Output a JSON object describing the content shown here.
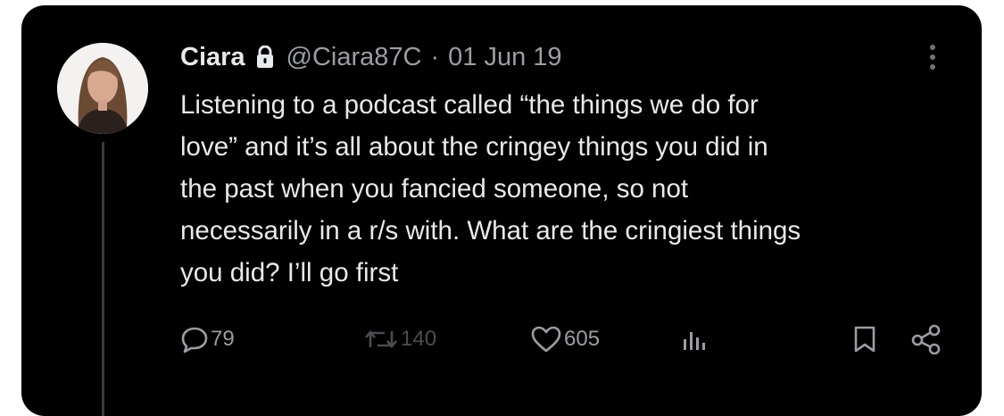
{
  "tweet": {
    "author_name": "Ciara",
    "handle": "@Ciara87C",
    "separator": "·",
    "date": "01 Jun 19",
    "protected_icon": "lock-icon",
    "text_lines": [
      "Listening to a podcast called “the things we do for",
      "love” and it’s all about the cringey things you did in",
      "the past when you fancied someone, so not",
      "necessarily in a r/s with. What are the cringiest things",
      "you did? I’ll go first"
    ]
  },
  "actions": {
    "reply": {
      "icon": "reply-icon",
      "count": "79"
    },
    "retweet": {
      "icon": "retweet-icon",
      "count": "140"
    },
    "like": {
      "icon": "heart-icon",
      "count": "605"
    },
    "views": {
      "icon": "views-icon"
    },
    "bookmark": {
      "icon": "bookmark-icon"
    },
    "share": {
      "icon": "share-icon"
    }
  },
  "colors": {
    "background": "#000000",
    "text": "#e7e9ea",
    "secondary_text": "#9a9ea3",
    "muted": "#4a4d51"
  }
}
